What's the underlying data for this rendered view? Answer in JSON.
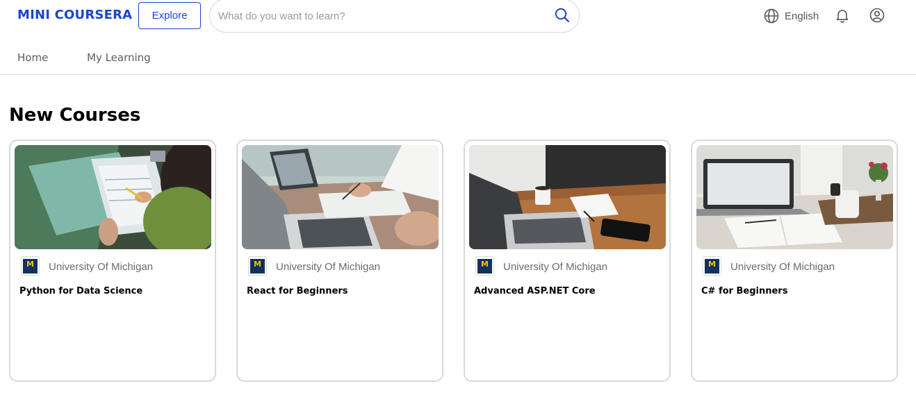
{
  "header": {
    "logo": "MINI COURSERA",
    "explore_label": "Explore",
    "search": {
      "placeholder": "What do you want to learn?",
      "value": "",
      "icon": "search-icon"
    },
    "language": {
      "label": "English",
      "icon": "globe-icon"
    },
    "notifications_icon": "bell-icon",
    "account_icon": "user-icon"
  },
  "nav": {
    "items": [
      {
        "label": "Home"
      },
      {
        "label": "My Learning"
      }
    ]
  },
  "section": {
    "title": "New Courses"
  },
  "courses": [
    {
      "partner": "University Of Michigan",
      "partner_logo_text": "M",
      "title": "Python for Data Science",
      "image": "people reviewing printed charts"
    },
    {
      "partner": "University Of Michigan",
      "partner_logo_text": "M",
      "title": "React for Beginners",
      "image": "hands writing at desk with laptops"
    },
    {
      "partner": "University Of Michigan",
      "partner_logo_text": "M",
      "title": "Advanced ASP.NET Core",
      "image": "laptop, coffee mug and phone on wooden desk"
    },
    {
      "partner": "University Of Michigan",
      "partner_logo_text": "M",
      "title": "C# for Beginners",
      "image": "laptop, open notebook and coffee cup"
    }
  ],
  "colors": {
    "brand": "#1b45c9",
    "partner_logo_bg": "#12315e",
    "partner_logo_fg": "#f2c300"
  }
}
